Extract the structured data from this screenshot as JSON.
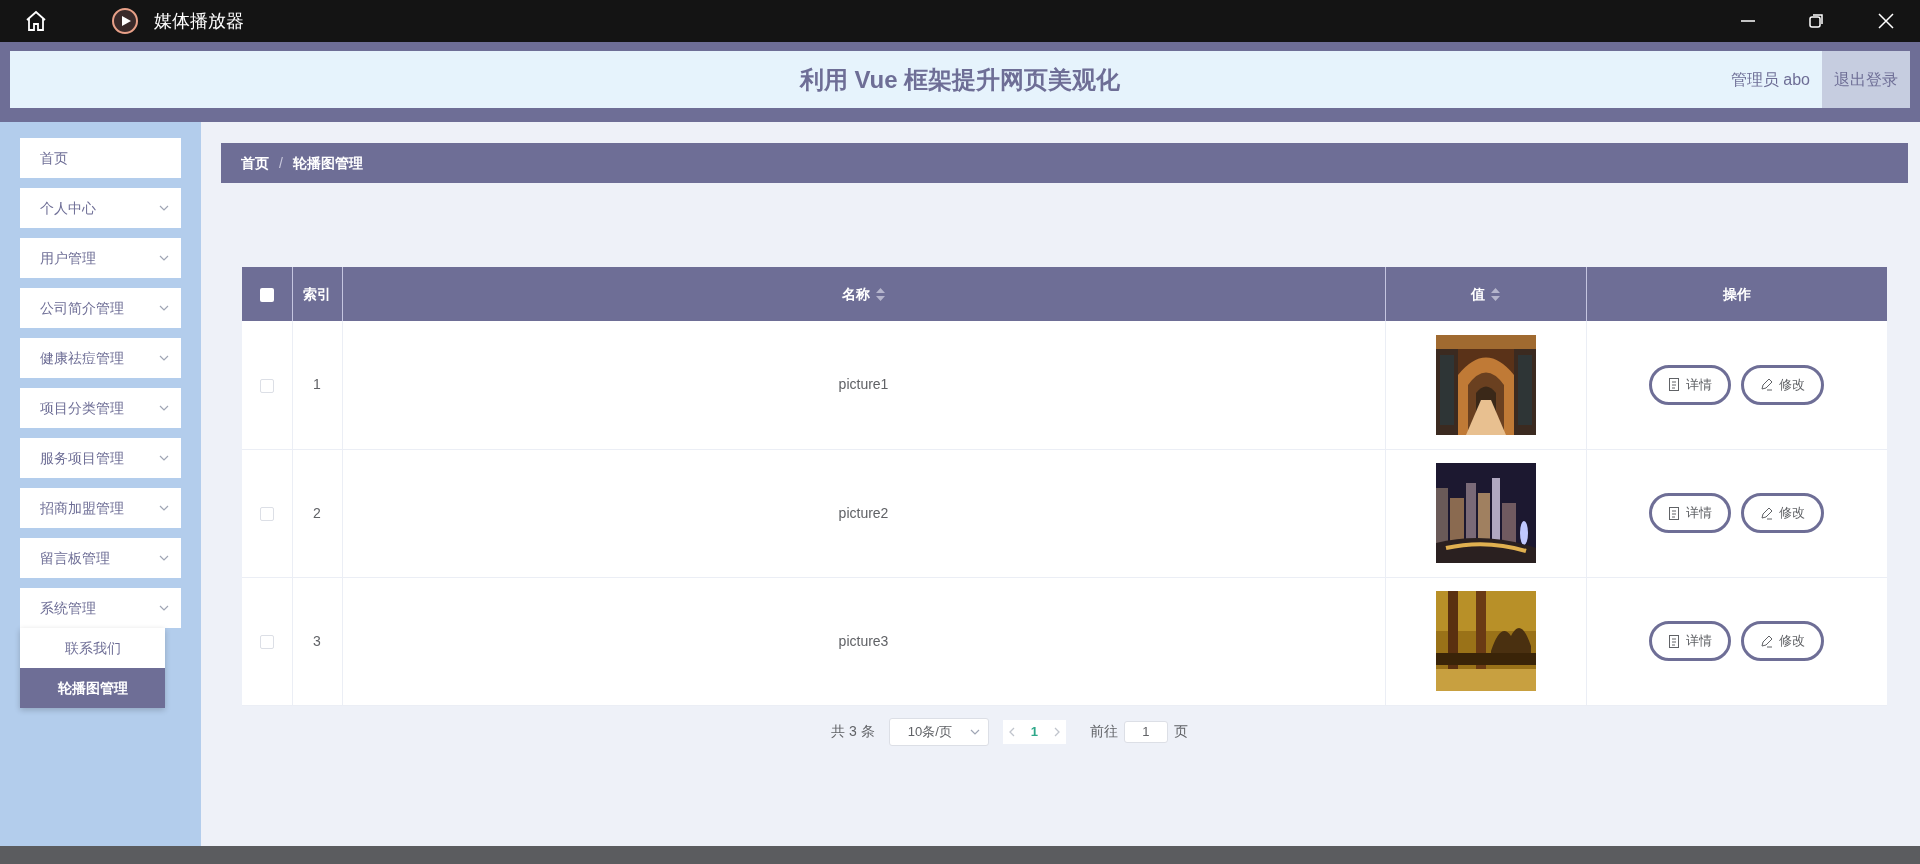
{
  "window": {
    "title": "媒体播放器"
  },
  "header": {
    "title": "利用 Vue 框架提升网页美观化",
    "user": "管理员 abo",
    "logout": "退出登录"
  },
  "sidebar": {
    "items": [
      {
        "label": "首页",
        "expandable": false
      },
      {
        "label": "个人中心",
        "expandable": true
      },
      {
        "label": "用户管理",
        "expandable": true
      },
      {
        "label": "公司简介管理",
        "expandable": true
      },
      {
        "label": "健康祛痘管理",
        "expandable": true
      },
      {
        "label": "项目分类管理",
        "expandable": true
      },
      {
        "label": "服务项目管理",
        "expandable": true
      },
      {
        "label": "招商加盟管理",
        "expandable": true
      },
      {
        "label": "留言板管理",
        "expandable": true
      },
      {
        "label": "系统管理",
        "expandable": true,
        "children": [
          {
            "label": "联系我们",
            "selected": false
          },
          {
            "label": "轮播图管理",
            "selected": true
          }
        ]
      }
    ]
  },
  "breadcrumb": {
    "items": [
      "首页",
      "轮播图管理"
    ],
    "separator": "/"
  },
  "table": {
    "select_all": {
      "checked": false
    },
    "columns": [
      {
        "label": "索引",
        "sortable": false
      },
      {
        "label": "名称",
        "sortable": true
      },
      {
        "label": "值",
        "sortable": true
      },
      {
        "label": "操作",
        "sortable": false
      }
    ],
    "rows": [
      {
        "checked": false,
        "index": "1",
        "name": "picture1",
        "value": {
          "kind": "picture"
        },
        "actions": [
          "详情",
          "修改"
        ]
      },
      {
        "checked": false,
        "index": "2",
        "name": "picture2",
        "value": {
          "kind": "picture"
        },
        "actions": [
          "详情",
          "修改"
        ]
      },
      {
        "checked": false,
        "index": "3",
        "name": "picture3",
        "value": {
          "kind": "picture"
        },
        "actions": [
          "详情",
          "修改"
        ]
      }
    ]
  },
  "pagination": {
    "total": "共 3 条",
    "page_size": "10条/页",
    "pages": [
      {
        "label": "1",
        "selected": true
      }
    ],
    "goto_label": "前往",
    "goto_value": "1",
    "goto_suffix": "页"
  }
}
